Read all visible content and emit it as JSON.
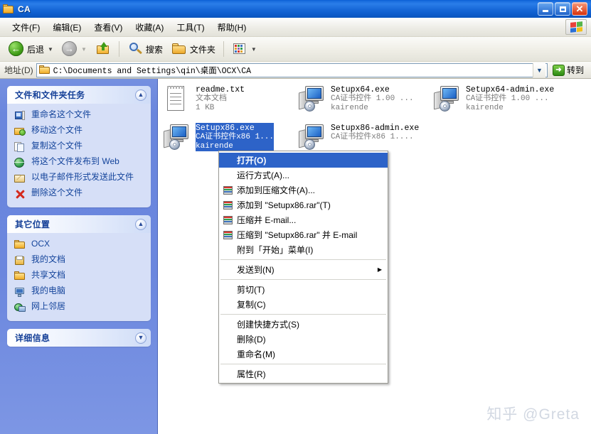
{
  "window": {
    "title": "CA",
    "icon": "folder-icon",
    "minimize_label": "最小化",
    "maximize_label": "最大化",
    "close_label": "关闭"
  },
  "menubar": {
    "items": [
      {
        "label": "文件(F)"
      },
      {
        "label": "编辑(E)"
      },
      {
        "label": "查看(V)"
      },
      {
        "label": "收藏(A)"
      },
      {
        "label": "工具(T)"
      },
      {
        "label": "帮助(H)"
      }
    ],
    "logo": "windows-flag-icon"
  },
  "toolbar": {
    "back_label": "后退",
    "forward_label": "",
    "up_label": "",
    "search_label": "搜索",
    "folders_label": "文件夹",
    "views_label": ""
  },
  "address": {
    "label": "地址(D)",
    "value": "C:\\Documents and Settings\\qin\\桌面\\OCX\\CA",
    "go_label": "转到"
  },
  "sidebar": {
    "panels": [
      {
        "title": "文件和文件夹任务",
        "collapsed": false,
        "chevron": "chevron-up-icon",
        "items": [
          {
            "label": "重命名这个文件",
            "icon": "rename-icon"
          },
          {
            "label": "移动这个文件",
            "icon": "move-icon"
          },
          {
            "label": "复制这个文件",
            "icon": "copy-icon"
          },
          {
            "label": "将这个文件发布到 Web",
            "icon": "web-publish-icon"
          },
          {
            "label": "以电子邮件形式发送此文件",
            "icon": "email-icon"
          },
          {
            "label": "删除这个文件",
            "icon": "delete-icon"
          }
        ]
      },
      {
        "title": "其它位置",
        "collapsed": false,
        "chevron": "chevron-up-icon",
        "items": [
          {
            "label": "OCX",
            "icon": "folder-icon"
          },
          {
            "label": "我的文档",
            "icon": "my-documents-icon"
          },
          {
            "label": "共享文档",
            "icon": "folder-icon"
          },
          {
            "label": "我的电脑",
            "icon": "my-computer-icon"
          },
          {
            "label": "网上邻居",
            "icon": "network-icon"
          }
        ]
      },
      {
        "title": "详细信息",
        "collapsed": true,
        "chevron": "chevron-down-icon",
        "items": []
      }
    ]
  },
  "files": [
    {
      "name": "readme.txt",
      "meta1": "文本文档",
      "meta2": "1 KB",
      "icon": "text-document-icon",
      "selected": false
    },
    {
      "name": "Setupx64.exe",
      "meta1": "CA证书控件 1.00 ...",
      "meta2": "kairende",
      "icon": "setup-executable-icon",
      "selected": false
    },
    {
      "name": "Setupx64-admin.exe",
      "meta1": "CA证书控件 1.00 ...",
      "meta2": "kairende",
      "icon": "setup-executable-icon",
      "selected": false
    },
    {
      "name": "Setupx86.exe",
      "meta1": "CA证书控件x86 1...",
      "meta2": "kairende",
      "icon": "setup-executable-icon",
      "selected": true
    },
    {
      "name": "Setupx86-admin.exe",
      "meta1": "CA证书控件x86 1....",
      "meta2": "",
      "icon": "setup-executable-icon",
      "selected": false
    }
  ],
  "context_menu": {
    "items": [
      {
        "label": "打开(O)",
        "icon": "",
        "bold": true,
        "highlighted": true,
        "submenu": false
      },
      {
        "label": "运行方式(A)...",
        "icon": "",
        "bold": false,
        "highlighted": false,
        "submenu": false
      },
      {
        "label": "添加到压缩文件(A)...",
        "icon": "rar-icon",
        "bold": false,
        "highlighted": false,
        "submenu": false
      },
      {
        "label": "添加到 \"Setupx86.rar\"(T)",
        "icon": "rar-icon",
        "bold": false,
        "highlighted": false,
        "submenu": false
      },
      {
        "label": "压缩并 E-mail...",
        "icon": "rar-icon",
        "bold": false,
        "highlighted": false,
        "submenu": false
      },
      {
        "label": "压缩到 \"Setupx86.rar\" 并 E-mail",
        "icon": "rar-icon",
        "bold": false,
        "highlighted": false,
        "submenu": false
      },
      {
        "label": "附到「开始」菜单(I)",
        "icon": "",
        "bold": false,
        "highlighted": false,
        "submenu": false
      },
      {
        "separator": true
      },
      {
        "label": "发送到(N)",
        "icon": "",
        "bold": false,
        "highlighted": false,
        "submenu": true
      },
      {
        "separator": true
      },
      {
        "label": "剪切(T)",
        "icon": "",
        "bold": false,
        "highlighted": false,
        "submenu": false
      },
      {
        "label": "复制(C)",
        "icon": "",
        "bold": false,
        "highlighted": false,
        "submenu": false
      },
      {
        "separator": true
      },
      {
        "label": "创建快捷方式(S)",
        "icon": "",
        "bold": false,
        "highlighted": false,
        "submenu": false
      },
      {
        "label": "删除(D)",
        "icon": "",
        "bold": false,
        "highlighted": false,
        "submenu": false
      },
      {
        "label": "重命名(M)",
        "icon": "",
        "bold": false,
        "highlighted": false,
        "submenu": false
      },
      {
        "separator": true
      },
      {
        "label": "属性(R)",
        "icon": "",
        "bold": false,
        "highlighted": false,
        "submenu": false
      }
    ]
  },
  "watermark": {
    "text": "知乎 @Greta"
  },
  "colors": {
    "titlebar_blue": "#1667d8",
    "sidebar_blue": "#6b87de",
    "panel_body": "#d6dff7",
    "panel_title": "#143f97",
    "link_blue": "#14449b",
    "selection_blue": "#2d63c8",
    "go_green": "#2c8a12"
  }
}
